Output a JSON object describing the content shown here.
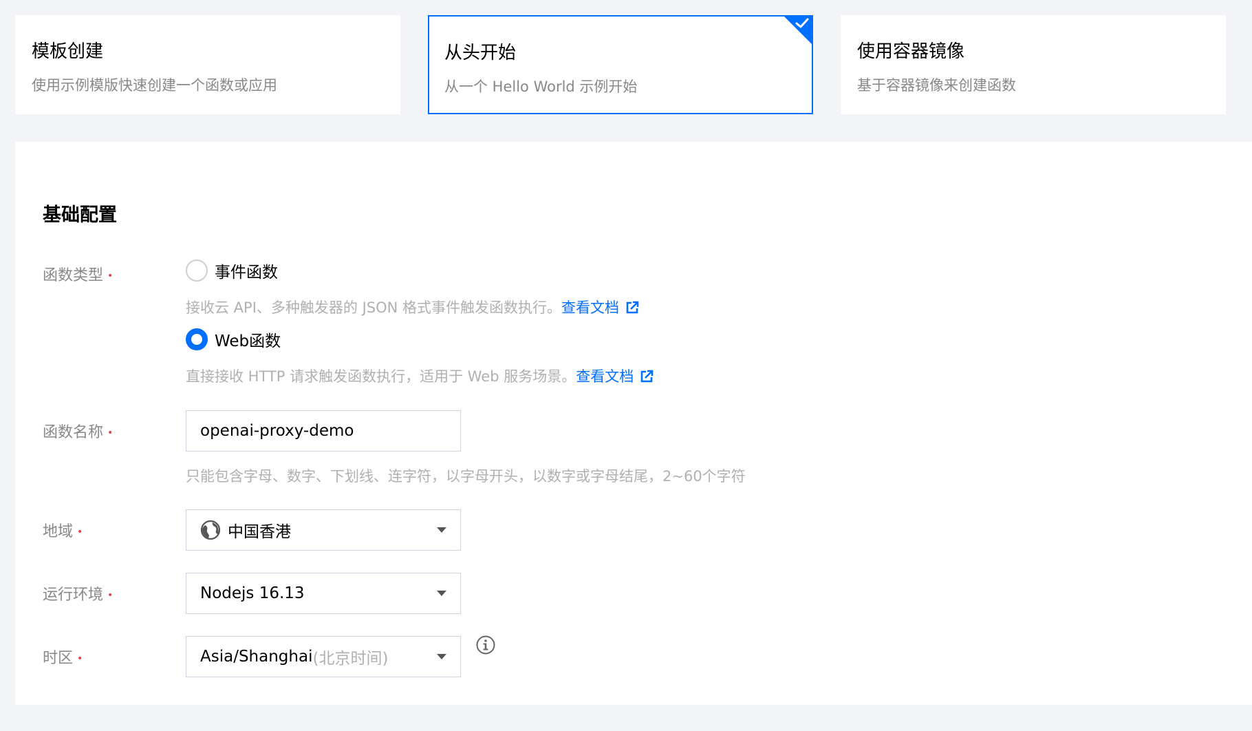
{
  "modes": [
    {
      "title": "模板创建",
      "desc": "使用示例模版快速创建一个函数或应用"
    },
    {
      "title": "从头开始",
      "desc": "从一个 Hello World 示例开始"
    },
    {
      "title": "使用容器镜像",
      "desc": "基于容器镜像来创建函数"
    }
  ],
  "basic": {
    "title": "基础配置",
    "func_type": {
      "label": "函数类型",
      "options": [
        {
          "label": "事件函数",
          "help": "接收云 API、多种触发器的 JSON 格式事件触发函数执行。",
          "link": "查看文档",
          "checked": false
        },
        {
          "label": "Web函数",
          "help": "直接接收 HTTP 请求触发函数执行，适用于 Web 服务场景。",
          "link": "查看文档",
          "checked": true
        }
      ]
    },
    "func_name": {
      "label": "函数名称",
      "value": "openai-proxy-demo",
      "help": "只能包含字母、数字、下划线、连字符，以字母开头，以数字或字母结尾，2~60个字符"
    },
    "region": {
      "label": "地域",
      "value": "中国香港"
    },
    "runtime": {
      "label": "运行环境",
      "value": "Nodejs 16.13"
    },
    "timezone": {
      "label": "时区",
      "value": "Asia/Shanghai",
      "note": "(北京时间)"
    }
  },
  "required_mark": "•",
  "colors": {
    "accent": "#006eff",
    "required": "#e54545"
  },
  "icons": {
    "selected": "check-icon",
    "doc_link": "external-link-icon",
    "region": "globe-icon",
    "dropdown": "chevron-down-icon",
    "timezone_info": "info-icon"
  }
}
